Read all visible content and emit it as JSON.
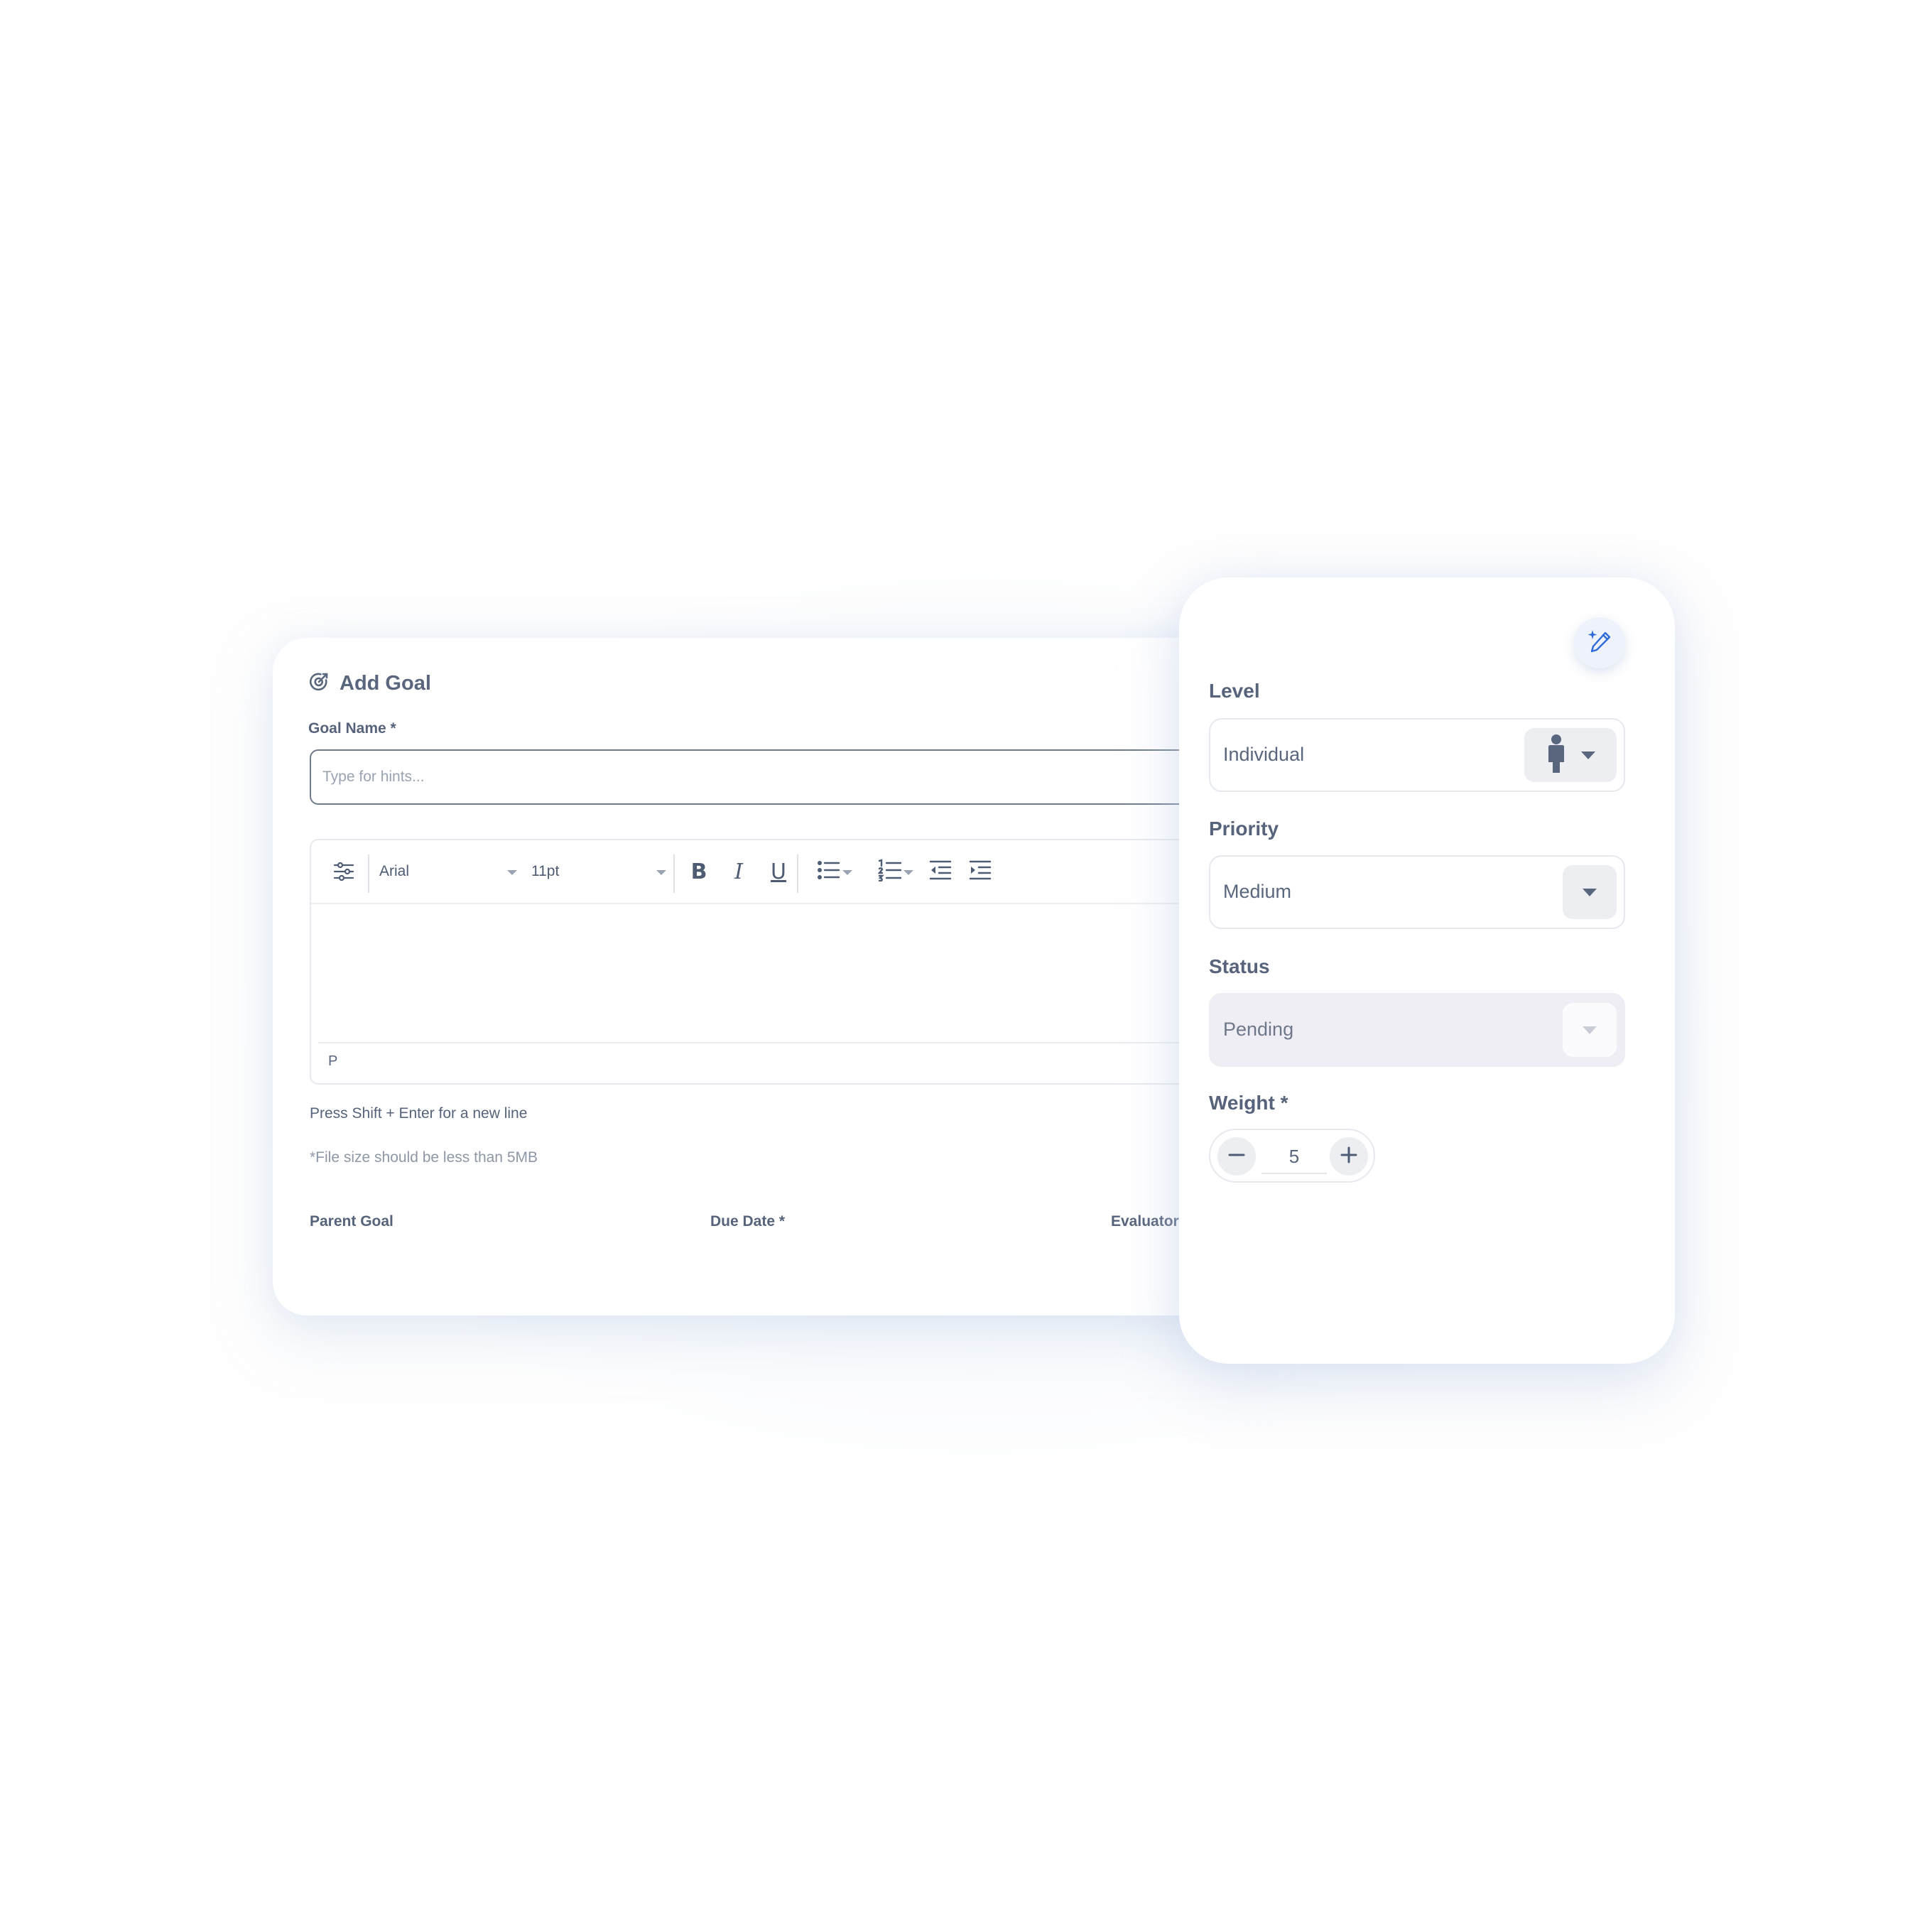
{
  "form": {
    "title": "Add Goal",
    "goal_name_label": "Goal Name *",
    "goal_name_placeholder": "Type for hints...",
    "goal_name_value": ""
  },
  "editor": {
    "font_family": "Arial",
    "font_size": "11pt",
    "buttons": [
      "settings-icon",
      "bold-icon",
      "italic-icon",
      "underline-icon",
      "bullet-list-icon",
      "numbered-list-icon",
      "outdent-icon",
      "indent-icon"
    ],
    "bold_label": "B",
    "italic_label": "I",
    "underline_label": "U",
    "status_path": "P"
  },
  "hints": {
    "shift_enter": "Press Shift + Enter for a new line",
    "file_size": "*File size should be less than 5MB"
  },
  "bottom_labels": {
    "parent_goal": "Parent Goal",
    "due_date": "Due Date *",
    "evaluator": "Evaluator"
  },
  "panel": {
    "ai_button_icon": "magic-pen-icon",
    "level": {
      "label": "Level",
      "value": "Individual",
      "icon": "person-icon"
    },
    "priority": {
      "label": "Priority",
      "value": "Medium"
    },
    "status": {
      "label": "Status",
      "value": "Pending",
      "disabled": true
    },
    "weight": {
      "label": "Weight *",
      "value": "5"
    }
  },
  "colors": {
    "text": "#4d5b73",
    "accent": "#2f6bd8",
    "input_border": "#6e7a8e",
    "disabled_bg": "#efeef4"
  }
}
